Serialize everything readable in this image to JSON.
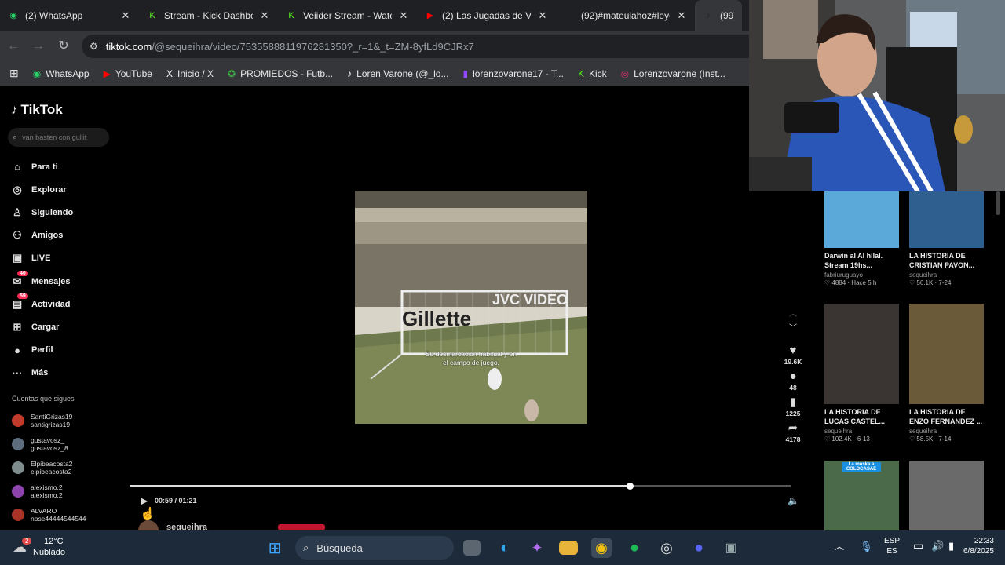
{
  "tabs": [
    {
      "title": "(2) WhatsApp",
      "color": "#25d366",
      "glyph": "◉"
    },
    {
      "title": "Stream - Kick Dashboard",
      "color": "#53fc18",
      "glyph": "K"
    },
    {
      "title": "Veiider Stream - Watch",
      "color": "#53fc18",
      "glyph": "K"
    },
    {
      "title": "(2) Las Jugadas de Ver",
      "color": "#ff0000",
      "glyph": "▶"
    },
    {
      "title": "(92)#mateulahoz#leye",
      "color": "#222222",
      "glyph": "♪"
    },
    {
      "title": "(99)L",
      "color": "#222222",
      "glyph": "♪"
    }
  ],
  "address": {
    "host": "tiktok.com",
    "path": "/@sequeihra/video/7535588811976281350?_r=1&_t=ZM-8yfLd9CJRx7"
  },
  "bookmarks": [
    {
      "label": "WhatsApp",
      "color": "#25d366",
      "glyph": "◉"
    },
    {
      "label": "YouTube",
      "color": "#ff0000",
      "glyph": "▶"
    },
    {
      "label": "Inicio / X",
      "color": "#ffffff",
      "glyph": "X"
    },
    {
      "label": "PROMIEDOS - Futb...",
      "color": "#3cb043",
      "glyph": "✪"
    },
    {
      "label": "Loren Varone (@_lo...",
      "color": "#ffffff",
      "glyph": "♪"
    },
    {
      "label": "lorenzovarone17 - T...",
      "color": "#9146ff",
      "glyph": "▮"
    },
    {
      "label": "Kick",
      "color": "#53fc18",
      "glyph": "K"
    },
    {
      "label": "Lorenzovarone (Inst...",
      "color": "#e1306c",
      "glyph": "◎"
    }
  ],
  "tiktok": {
    "logo": "TikTok",
    "search_placeholder": "van basten con gullit",
    "nav": [
      {
        "label": "Para ti",
        "icon": "⌂",
        "badge": ""
      },
      {
        "label": "Explorar",
        "icon": "◎",
        "badge": ""
      },
      {
        "label": "Siguiendo",
        "icon": "♙",
        "badge": ""
      },
      {
        "label": "Amigos",
        "icon": "⚇",
        "badge": ""
      },
      {
        "label": "LIVE",
        "icon": "▣",
        "badge": ""
      },
      {
        "label": "Mensajes",
        "icon": "✉",
        "badge": "40"
      },
      {
        "label": "Actividad",
        "icon": "▤",
        "badge": "59"
      },
      {
        "label": "Cargar",
        "icon": "⊞",
        "badge": ""
      },
      {
        "label": "Perfil",
        "icon": "●",
        "badge": ""
      },
      {
        "label": "Más",
        "icon": "···",
        "badge": ""
      }
    ],
    "following_header": "Cuentas que sigues",
    "following": [
      {
        "name": "SantiGrizas19",
        "handle": "santigrizas19",
        "color": "#c0392b"
      },
      {
        "name": "gustavosz_",
        "handle": "gustavosz_8",
        "color": "#5d6d7e"
      },
      {
        "name": "Elpibeacosta2",
        "handle": "elpibeacosta2",
        "color": "#7f8c8d"
      },
      {
        "name": "alexismo.2",
        "handle": "alexismo.2",
        "color": "#8e44ad"
      },
      {
        "name": "ALVARO",
        "handle": "nose44444544544",
        "color": "#a93226"
      }
    ]
  },
  "video": {
    "caption_line1": "Su desmarcación habitual y en",
    "caption_line2": "el campo de juego.",
    "time": "00:59 / 01:21",
    "progress": 0.756,
    "author": "sequeihra",
    "likes": "19.6K",
    "comments": "48",
    "saves": "1225",
    "shares": "4178"
  },
  "recommended": [
    {
      "title1": "Darwin al Al hilal.",
      "title2": "Stream 19hs...",
      "author": "fabriuruguayo",
      "meta": "♡ 4884 · Hace 5 h",
      "color": "#5aa9d8"
    },
    {
      "title1": "LA HISTORIA DE",
      "title2": "CRISTIAN PAVON...",
      "author": "sequeihra",
      "meta": "♡ 56.1K · 7-24",
      "color": "#2f5f8f"
    },
    {
      "title1": "LA HISTORIA DE",
      "title2": "LUCAS CASTEL...",
      "author": "sequeihra",
      "meta": "♡ 102.4K · 6-13",
      "color": "#3a3432"
    },
    {
      "title1": "LA HISTORIA DE",
      "title2": "ENZO FERNANDEZ ...",
      "author": "sequeihra",
      "meta": "♡ 58.5K · 7-14",
      "color": "#6b5a3a"
    },
    {
      "title1": "",
      "title2": "",
      "author": "",
      "meta": "",
      "color": "#4a6a4a",
      "label": "La moska a COLOCASAE"
    },
    {
      "title1": "",
      "title2": "",
      "author": "",
      "meta": "",
      "color": "#6a6a6a"
    }
  ],
  "taskbar": {
    "weather_temp": "12°C",
    "weather_desc": "Nublado",
    "weather_badge": "2",
    "search_label": "Búsqueda",
    "lang1": "ESP",
    "lang2": "ES",
    "time": "22:33",
    "date": "6/8/2025"
  }
}
